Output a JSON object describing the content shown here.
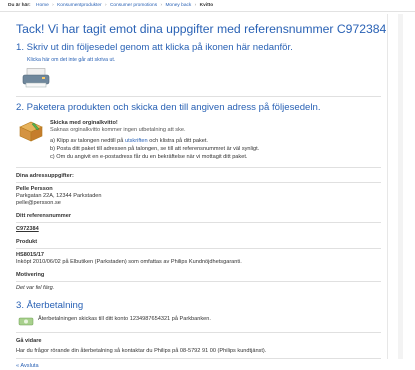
{
  "breadcrumb": {
    "prefix": "Du är här:",
    "items": [
      "Home",
      "Konsumentprodukter",
      "Consumer promotions",
      "Money back",
      "Kvitto"
    ]
  },
  "page": {
    "title": "Tack! Vi har tagit emot dina uppgifter med referensnummer C972384",
    "step1": {
      "heading": "1. Skriv ut din följesedel genom att klicka på ikonen här nedanför.",
      "link": "Klicka här om det inte går att skriva ut."
    },
    "step2": {
      "heading": "2. Paketera produkten och skicka den till angiven adress på följesedeln.",
      "box_title": "Skicka med orginalkvitto!",
      "box_sub": "Saknas orginalkvitto kommer ingen utbetalning att ske.",
      "list": [
        {
          "prefix": "a) Klipp av talongen nedtill på ",
          "link": "utskriften",
          "suffix": " och klistra på ditt paket."
        },
        {
          "prefix": "b) Posta ditt paket till adressen på talongen, se till att referensnummret är väl synligt.",
          "link": "",
          "suffix": ""
        },
        {
          "prefix": "c) Om du angivit en e-postadress får du en bekräftelse när vi mottagit ditt paket.",
          "link": "",
          "suffix": ""
        }
      ]
    },
    "address": {
      "label": "Dina adressuppgifter:",
      "name": "Pelle Persson",
      "street": "Parkgatan 22A, 12344 Parkstaden",
      "email": "pelle@persson.se"
    },
    "reference": {
      "label": "Ditt referensnummer",
      "value": "C972384"
    },
    "product": {
      "label": "Produkt",
      "value": "HS8015/17",
      "desc": "Inköpt 2010/06/02 på Elbutiken (Parkstaden) som omfattas av Philips Kundnöjdhetsgaranti."
    },
    "motivation": {
      "label": "Motivering",
      "value": "Det var fel färg."
    },
    "step3": {
      "heading": "3. Återbetalning",
      "text": "Återbetalningen skickas till ditt konto 1234987654321 på Parkbanken."
    },
    "next": {
      "label": "Gå vidare",
      "text": "Har du frågor rörande din återbetalning så kontaktar du Philips på 08-5792 91 00 (Philips kundtjänst).",
      "finish_link": "« Avsluta"
    }
  },
  "colors": {
    "accent": "#2a62b5",
    "text": "#333333",
    "orange": "#e89a2a"
  },
  "icons": {
    "printer": "printer-icon",
    "box": "package-icon"
  }
}
